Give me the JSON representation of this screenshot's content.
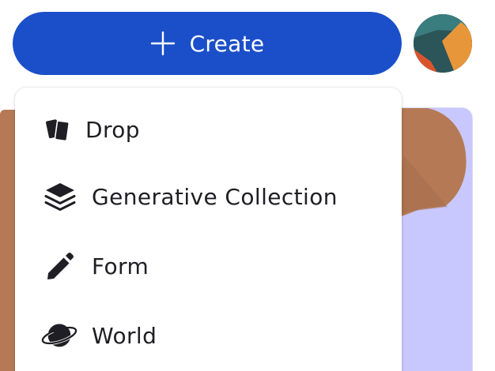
{
  "header": {
    "create_label": "Create",
    "create_icon": "plus-icon"
  },
  "avatar": {
    "icon": "avatar-icon",
    "colors": [
      "#2b5558",
      "#e8963a",
      "#d9542c"
    ]
  },
  "menu": {
    "items": [
      {
        "label": "Drop",
        "icon": "cards-icon"
      },
      {
        "label": "Generative Collection",
        "icon": "layers-icon"
      },
      {
        "label": "Form",
        "icon": "pencil-icon"
      },
      {
        "label": "World",
        "icon": "planet-icon"
      }
    ]
  },
  "colors": {
    "accent": "#1b4fc9",
    "menu_text": "#1e1e24",
    "background_card": "#c8c8ff",
    "background_art": "#b57a55"
  }
}
